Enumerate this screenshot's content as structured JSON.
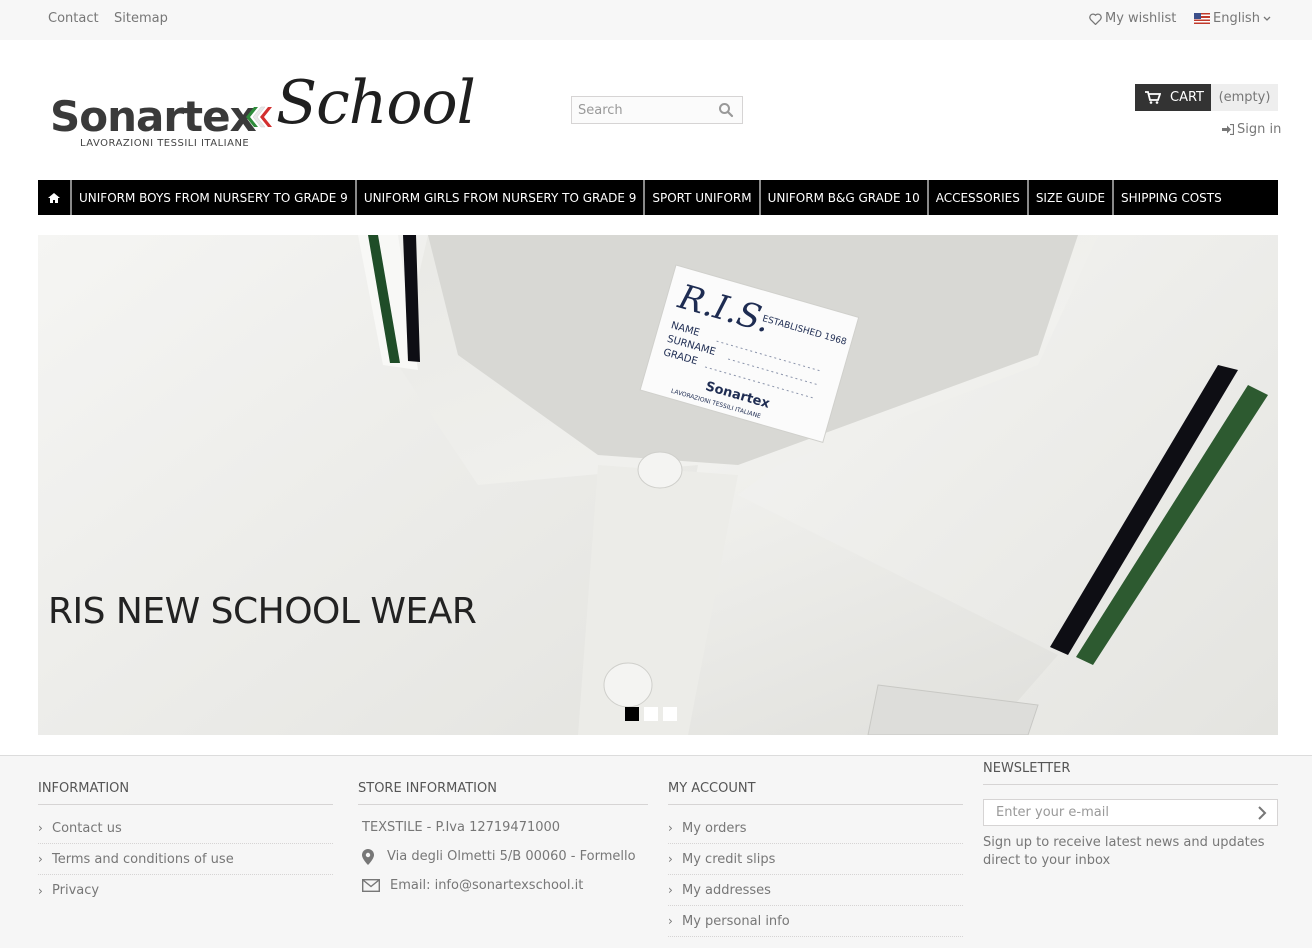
{
  "topbar": {
    "contact": "Contact",
    "sitemap": "Sitemap",
    "wishlist": "My wishlist",
    "language": "English"
  },
  "logo": {
    "brand": "Sonartex",
    "sub": "School",
    "tagline": "LAVORAZIONI TESSILI ITALIANE"
  },
  "search": {
    "placeholder": "Search"
  },
  "cart": {
    "label": "CART",
    "status": "(empty)"
  },
  "account": {
    "signin": "Sign in"
  },
  "nav": {
    "items": [
      "UNIFORM BOYS FROM NURSERY TO GRADE 9",
      "UNIFORM GIRLS FROM NURSERY TO GRADE 9",
      "SPORT UNIFORM",
      "UNIFORM B&G GRADE 10",
      "ACCESSORIES",
      "SIZE GUIDE",
      "SHIPPING COSTS"
    ]
  },
  "slider": {
    "caption": "RIS NEW SCHOOL WEAR",
    "label": {
      "brand": "R.I.S.",
      "established": "ESTABLISHED 1968",
      "name": "NAME",
      "surname": "SURNAME",
      "grade": "GRADE",
      "maker": "Sonartex",
      "maker_tag": "LAVORAZIONI TESSILI ITALIANE"
    },
    "active_slide": 1,
    "slide_count": 3
  },
  "footer": {
    "information": {
      "title": "INFORMATION",
      "links": [
        "Contact us",
        "Terms and conditions of use",
        "Privacy"
      ]
    },
    "store": {
      "title": "STORE INFORMATION",
      "company": "TEXSTILE - P.Iva 12719471000",
      "address": "Via degli Olmetti 5/B 00060 - Formello",
      "email": "Email: info@sonartexschool.it"
    },
    "account": {
      "title": "MY ACCOUNT",
      "links": [
        "My orders",
        "My credit slips",
        "My addresses",
        "My personal info"
      ]
    },
    "newsletter": {
      "title": "NEWSLETTER",
      "placeholder": "Enter your e-mail",
      "description": "Sign up to receive latest news and updates direct to your inbox"
    }
  }
}
